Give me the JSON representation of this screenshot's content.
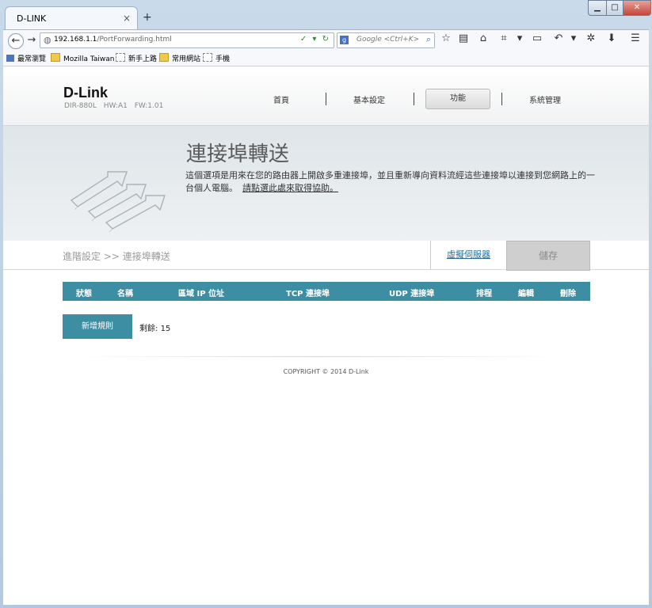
{
  "browser": {
    "tab_title": "D-LINK",
    "tab_close": "×",
    "new_tab": "+",
    "window_controls": {
      "minimize": "▁",
      "maximize": "□",
      "close": "✕"
    },
    "url_host": "192.168.1.1",
    "url_path": "/PortForwarding.html",
    "search_engine": "g",
    "search_placeholder": "Google <Ctrl+K>",
    "bookmarks": [
      "最常瀏覽",
      "Mozilla Taiwan",
      "新手上路",
      "常用網站",
      "手機"
    ]
  },
  "router": {
    "logo": "D-Link",
    "model": "DIR-880L  HW:A1  FW:1.01",
    "menu": [
      "首頁",
      "基本設定",
      "功能",
      "系統管理"
    ]
  },
  "hero": {
    "title": "連接埠轉送",
    "description": "這個選項是用來在您的路由器上開啟多重連接埠，並且重新導向資料流經這些連接埠以連接到您網路上的一台個人電腦。",
    "help_link": "請點選此處來取得協助。"
  },
  "breadcrumb": "進階設定 >> 連接埠轉送",
  "buttons": {
    "virtual_server": "虛擬伺服器",
    "save": "儲存",
    "add_rule": "新增規則"
  },
  "table_headers": [
    "狀態",
    "名稱",
    "區域 IP 位址",
    "TCP 連接埠",
    "UDP 連接埠",
    "排程",
    "編輯",
    "刪除"
  ],
  "remaining": {
    "label": "剩餘:",
    "count": "15"
  },
  "footer": "COPYRIGHT © 2014 D-Link"
}
